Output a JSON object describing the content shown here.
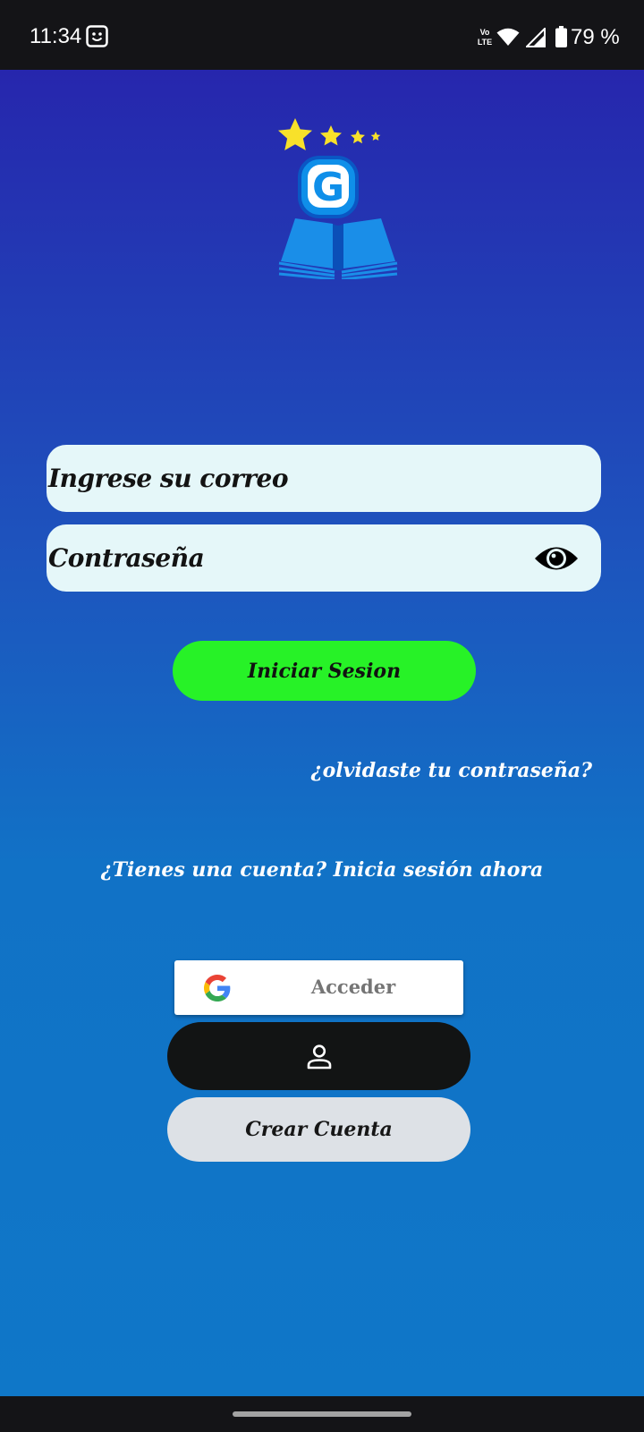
{
  "status_bar": {
    "time": "11:34",
    "battery": "79 %",
    "icons": [
      "smiley-icon",
      "volte-icon",
      "wifi-icon",
      "signal-icon",
      "battery-icon"
    ]
  },
  "logo": {
    "letter": "G",
    "icon": "book-logo-icon"
  },
  "form": {
    "email_placeholder": "Ingrese su correo",
    "password_placeholder": "Contraseña",
    "login_label": "Iniciar Sesion",
    "forgot_label": "¿olvidaste tu contraseña?",
    "account_label": "¿Tienes una cuenta? Inicia sesión ahora"
  },
  "google": {
    "label": "Acceder",
    "icon": "google-icon"
  },
  "guest": {
    "icon": "person-icon"
  },
  "create": {
    "label": "Crear Cuenta"
  },
  "colors": {
    "gradient_top": "#2626ad",
    "gradient_bottom": "#0f77c8",
    "field_bg": "#e5f7f9",
    "login_green": "#27f227",
    "guest_black": "#121414",
    "create_gray": "#dde1e6",
    "star_yellow": "#f8e12a"
  }
}
